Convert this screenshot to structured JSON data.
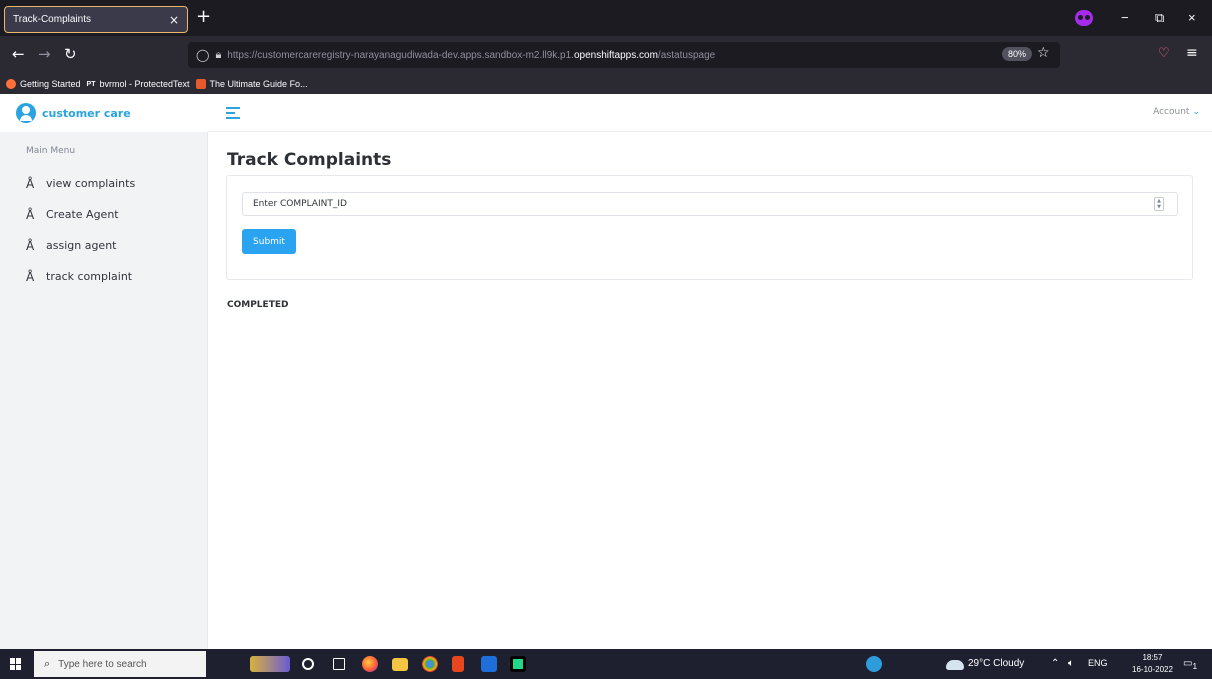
{
  "browser": {
    "tab_title": "Track-Complaints",
    "tab_close": "×",
    "new_tab": "+",
    "minimize": "−",
    "restore": "⧉",
    "close": "×",
    "url_prefix": "https://customercareregistry-narayanagudiwada-dev.apps.sandbox-m2.ll9k.p1.",
    "url_host": "openshiftapps.com",
    "url_path": "/astatuspage",
    "zoom": "80%",
    "bookmarks": [
      "Getting Started",
      "bvrmol - ProtectedText",
      "The Ultimate Guide Fo..."
    ],
    "bookmark_pt_badge": "PT"
  },
  "sidebar": {
    "brand": "customer care",
    "heading": "Main Menu",
    "items": [
      {
        "label": "view complaints"
      },
      {
        "label": "Create Agent"
      },
      {
        "label": "assign agent"
      },
      {
        "label": "track complaint"
      }
    ]
  },
  "topbar": {
    "account": "Account"
  },
  "main": {
    "title": "Track Complaints",
    "input_placeholder": "Enter COMPLAINT_ID",
    "submit_label": "Submit",
    "status": "COMPLETED"
  },
  "taskbar": {
    "search_placeholder": "Type here to search",
    "weather": "29°C Cloudy",
    "lang": "ENG",
    "time": "18:57",
    "date": "16-10-2022",
    "notifications": "1"
  },
  "colors": {
    "accent": "#2aa3df",
    "submit": "#2aa3f0",
    "tab_border": "#e9b86b"
  }
}
